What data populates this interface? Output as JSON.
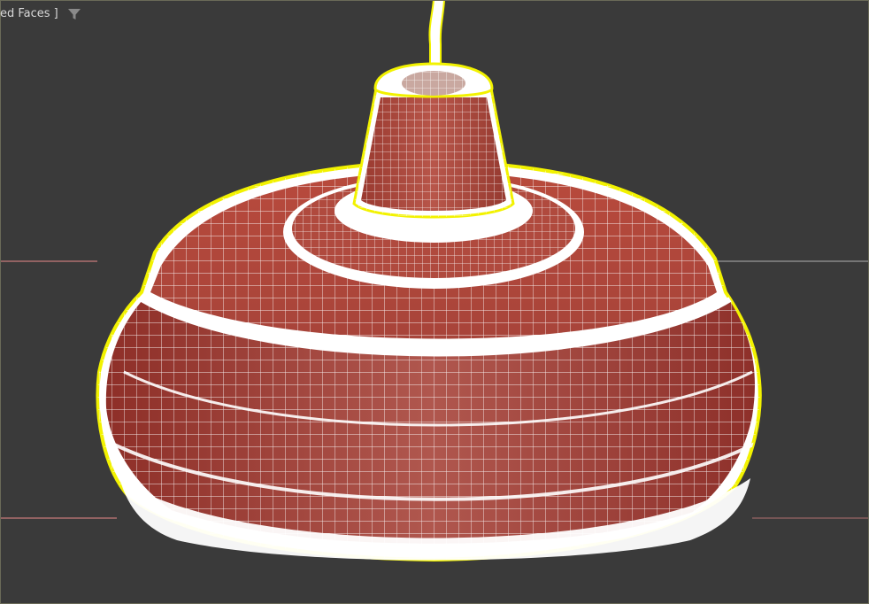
{
  "viewport": {
    "label": "ed Faces ]",
    "filter_icon": "filter-funnel-icon",
    "background_color": "#3a3a3a",
    "selection_color": "#f2f200",
    "wire_color": "#ffffff",
    "shade_color": "#b24a3c"
  }
}
